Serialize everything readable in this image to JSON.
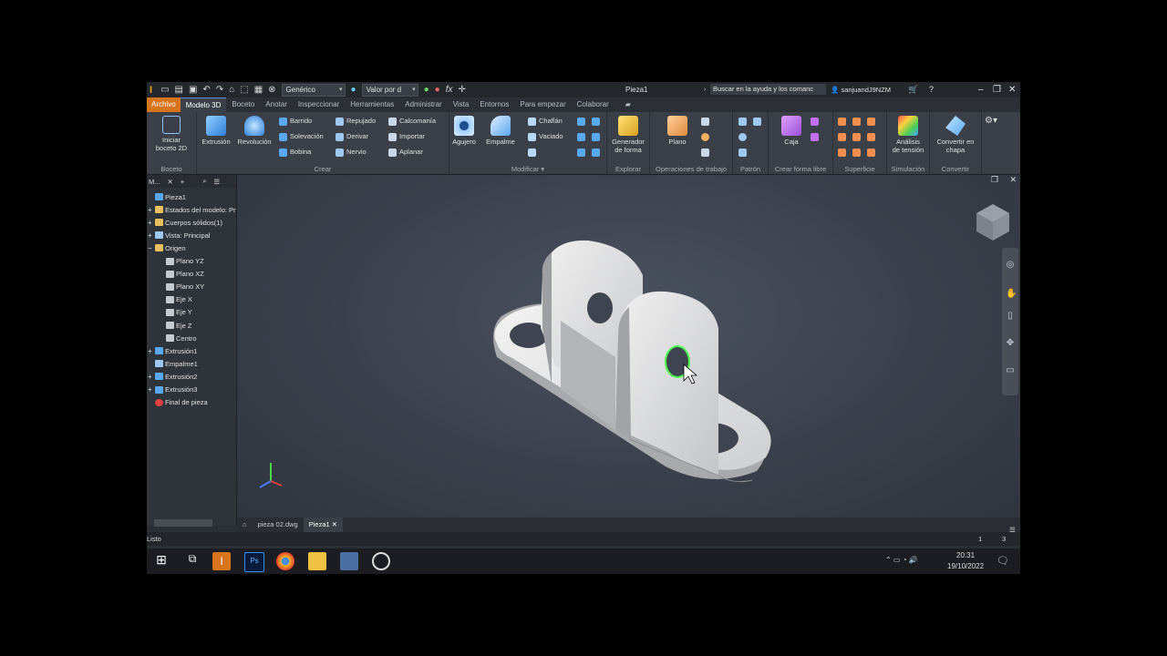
{
  "titlebar": {
    "appearance": "Genérico",
    "material": "Valor por d",
    "doc_title": "Pieza1",
    "help_search": "Buscar en la ayuda y los comanc",
    "user": "sanjuandJ9NZM"
  },
  "menu_tabs": [
    "Archivo",
    "Modelo 3D",
    "Boceto",
    "Anotar",
    "Inspeccionar",
    "Herramientas",
    "Administrar",
    "Vista",
    "Entornos",
    "Para empezar",
    "Colaborar"
  ],
  "ribbon": {
    "boceto": {
      "label": "Boceto",
      "start_sketch_line1": "Iniciar",
      "start_sketch_line2": "boceto 2D"
    },
    "crear": {
      "label": "Crear",
      "extrusion": "Extrusión",
      "revolucion": "Revolución",
      "barrido": "Barrido",
      "solevacion": "Solevación",
      "bobina": "Bobina",
      "repujado": "Repujado",
      "derivar": "Derivar",
      "nervio": "Nervio",
      "calcomania": "Calcomanía",
      "importar": "Importar",
      "aplanar": "Aplanar"
    },
    "modificar": {
      "label": "Modificar",
      "agujero": "Agujero",
      "empalme": "Empalme",
      "chaflan": "Chaflán",
      "vaciado": "Vaciado"
    },
    "explorar": {
      "label": "Explorar",
      "gen_line1": "Generador",
      "gen_line2": "de forma"
    },
    "operaciones": {
      "label": "Operaciones de trabajo",
      "plano": "Plano"
    },
    "patron": {
      "label": "Patrón"
    },
    "forma_libre": {
      "label": "Crear forma libre",
      "caja": "Caja"
    },
    "superficie": {
      "label": "Superficie"
    },
    "simulacion": {
      "label": "Simulación",
      "line1": "Análisis",
      "line2": "de tensión"
    },
    "convertir": {
      "label": "Convertir",
      "line1": "Convertir en",
      "line2": "chapa"
    }
  },
  "browser": {
    "header": "M...",
    "items": [
      {
        "label": "Pieza1",
        "indent": 0,
        "expander": "",
        "icon": "part"
      },
      {
        "label": "Estados del modelo: Pr",
        "indent": 1,
        "expander": "+",
        "icon": "folder"
      },
      {
        "label": "Cuerpos sólidos(1)",
        "indent": 1,
        "expander": "+",
        "icon": "folder"
      },
      {
        "label": "Vista: Principal",
        "indent": 1,
        "expander": "+",
        "icon": "view"
      },
      {
        "label": "Origen",
        "indent": 1,
        "expander": "−",
        "icon": "folder"
      },
      {
        "label": "Plano YZ",
        "indent": 2,
        "expander": "",
        "icon": "plane"
      },
      {
        "label": "Plano XZ",
        "indent": 2,
        "expander": "",
        "icon": "plane"
      },
      {
        "label": "Plano XY",
        "indent": 2,
        "expander": "",
        "icon": "plane"
      },
      {
        "label": "Eje X",
        "indent": 2,
        "expander": "",
        "icon": "axis"
      },
      {
        "label": "Eje Y",
        "indent": 2,
        "expander": "",
        "icon": "axis"
      },
      {
        "label": "Eje Z",
        "indent": 2,
        "expander": "",
        "icon": "axis"
      },
      {
        "label": "Centro",
        "indent": 2,
        "expander": "",
        "icon": "point"
      },
      {
        "label": "Extrusión1",
        "indent": 1,
        "expander": "+",
        "icon": "feature"
      },
      {
        "label": "Empalme1",
        "indent": 1,
        "expander": "",
        "icon": "fillet"
      },
      {
        "label": "Extrusión2",
        "indent": 1,
        "expander": "+",
        "icon": "feature"
      },
      {
        "label": "Extrusión3",
        "indent": 1,
        "expander": "+",
        "icon": "feature"
      },
      {
        "label": "Final de pieza",
        "indent": 1,
        "expander": "",
        "icon": "end"
      }
    ]
  },
  "doc_tabs": [
    "pieza 02.dwg",
    "Pieza1"
  ],
  "status": {
    "text": "Listo",
    "count1": "1",
    "count2": "3"
  },
  "taskbar": {
    "time": "20:31",
    "date": "19/10/2022"
  },
  "colors": {
    "accent": "#d8751c",
    "highlight": "#4cff4c",
    "ribbon_bg": "#3b4048"
  }
}
